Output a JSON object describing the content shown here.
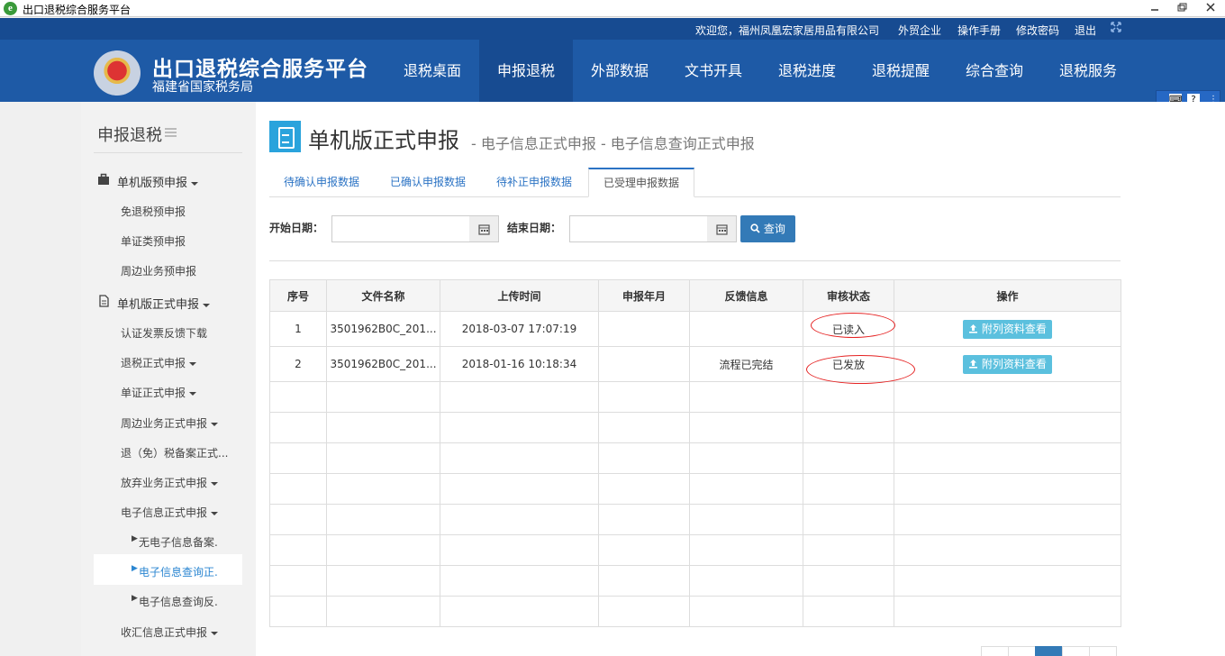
{
  "window": {
    "title": "出口退税综合服务平台",
    "app_icon": "e"
  },
  "topbar": {
    "welcome": "欢迎您，福州凤凰宏家居用品有限公司",
    "links": [
      "外贸企业",
      "操作手册",
      "修改密码",
      "退出"
    ]
  },
  "brand": {
    "title": "出口退税综合服务平台",
    "subtitle": "福建省国家税务局"
  },
  "nav": {
    "items": [
      "退税桌面",
      "申报退税",
      "外部数据",
      "文书开具",
      "退税进度",
      "退税提醒",
      "综合查询",
      "退税服务"
    ],
    "active": "申报退税"
  },
  "sidebar": {
    "title": "申报退税",
    "groups": [
      {
        "label": "单机版预申报",
        "icon": "briefcase-icon",
        "items": [
          "免退税预申报",
          "单证类预申报",
          "周边业务预申报"
        ]
      },
      {
        "label": "单机版正式申报",
        "icon": "document-icon",
        "items": [
          "认证发票反馈下载",
          "退税正式申报",
          "单证正式申报",
          "周边业务正式申报",
          "退（免）税备案正式...",
          "放弃业务正式申报",
          "电子信息正式申报"
        ],
        "subitems": [
          "无电子信息备案.",
          "电子信息查询正.",
          "电子信息查询反."
        ],
        "after": "收汇信息正式申报"
      }
    ]
  },
  "page": {
    "title": "单机版正式申报",
    "breadcrumb": "- 电子信息正式申报 - 电子信息查询正式申报",
    "tabs": [
      "待确认申报数据",
      "已确认申报数据",
      "待补正申报数据",
      "已受理申报数据"
    ],
    "active_tab": "已受理申报数据"
  },
  "filter": {
    "start_label": "开始日期：",
    "start_value": "",
    "end_label": "结束日期：",
    "end_value": "",
    "query_label": "查询"
  },
  "table": {
    "headers": [
      "序号",
      "文件名称",
      "上传时间",
      "申报年月",
      "反馈信息",
      "审核状态",
      "操作"
    ],
    "rows": [
      {
        "no": "1",
        "file": "3501962B0C_201...",
        "upload": "2018-03-07 17:07:19",
        "month": "",
        "feedback": "",
        "status": "已读入",
        "action": "附列资料查看"
      },
      {
        "no": "2",
        "file": "3501962B0C_201...",
        "upload": "2018-01-16 10:18:34",
        "month": "",
        "feedback": "流程已完结",
        "status": "已发放",
        "action": "附列资料查看"
      }
    ],
    "empty_rows": 8
  },
  "colors": {
    "header": "#1e5aa6",
    "topbar": "#174b91",
    "primary": "#337ab7",
    "info": "#5bc0de",
    "accent": "#2aa3dc",
    "annotation": "#e52222"
  }
}
